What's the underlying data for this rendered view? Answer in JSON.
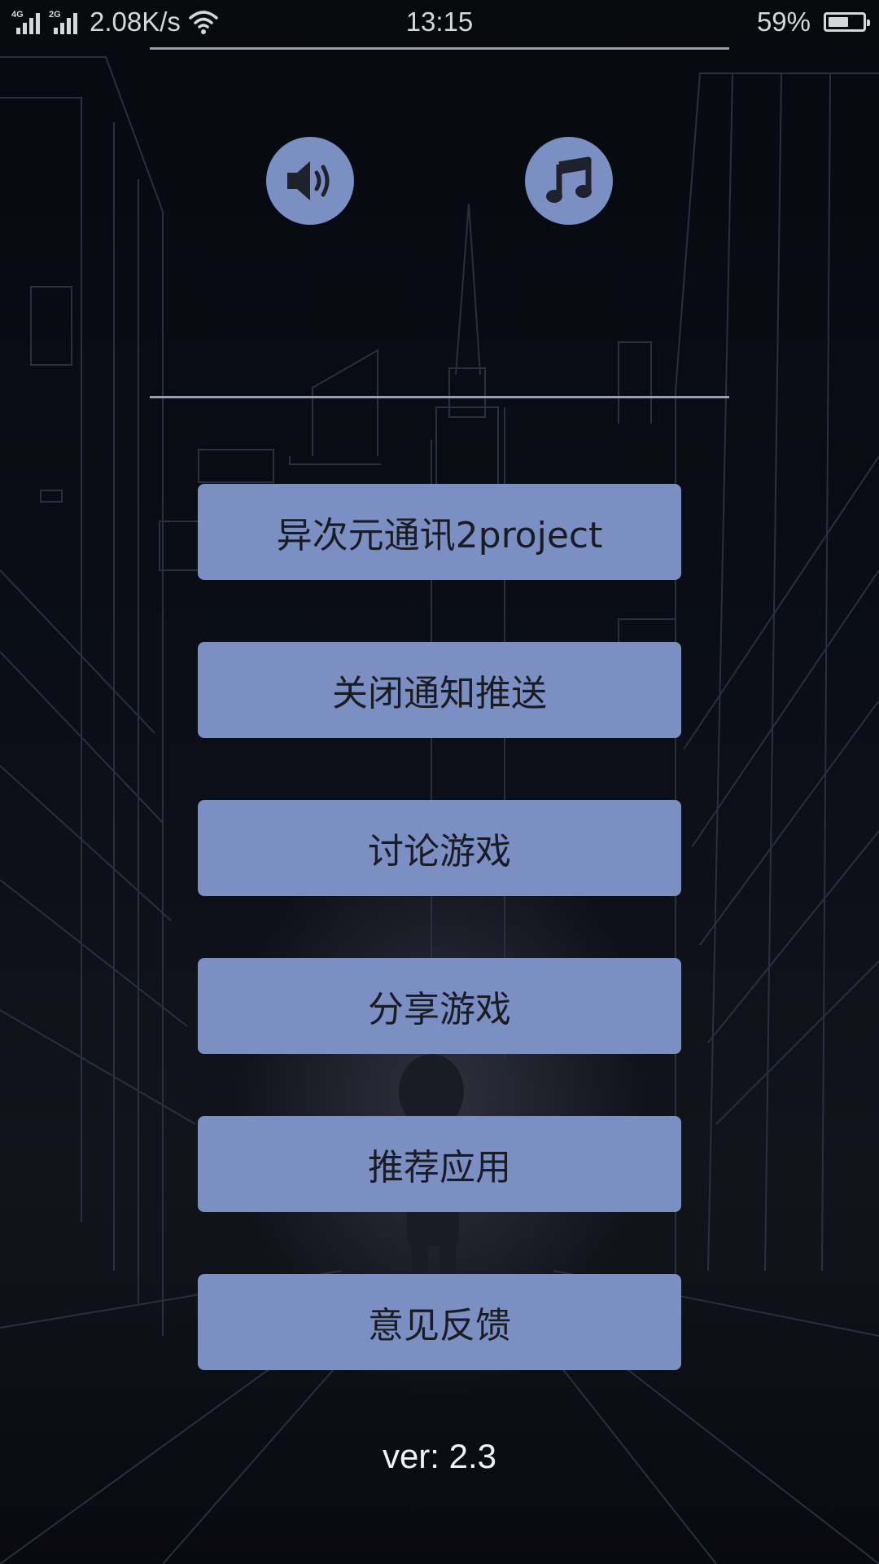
{
  "status_bar": {
    "signal_1_label": "4G",
    "signal_2_label": "2G",
    "net_speed": "2.08K/s",
    "wifi_icon": "wifi-icon",
    "time": "13:15",
    "battery_percent": "59%",
    "battery_level": 0.59
  },
  "controls": {
    "sound_icon": "speaker-volume-icon",
    "music_icon": "music-note-icon"
  },
  "menu": {
    "items": [
      {
        "label": "异次元通讯2project"
      },
      {
        "label": "关闭通知推送"
      },
      {
        "label": "讨论游戏"
      },
      {
        "label": "分享游戏"
      },
      {
        "label": "推荐应用"
      },
      {
        "label": "意见反馈"
      }
    ]
  },
  "version": "ver: 2.3",
  "colors": {
    "button_fill": "#7b8fc2",
    "background": "#0b0d15",
    "divider": "#9a9fae",
    "button_text": "#1a1c24"
  }
}
